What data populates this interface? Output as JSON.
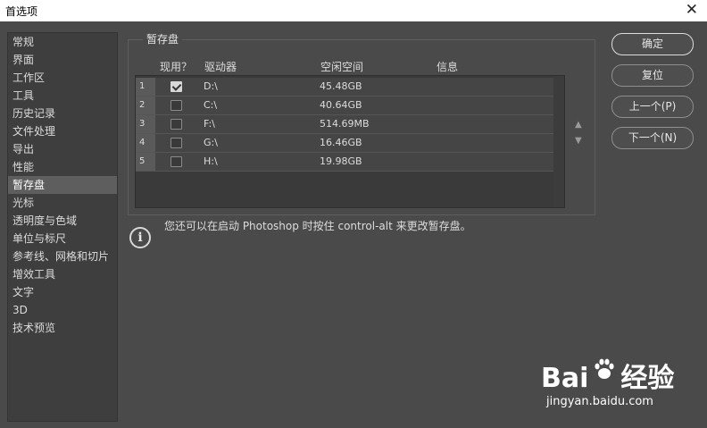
{
  "window": {
    "title": "首选项",
    "close_icon": "✕"
  },
  "sidebar": {
    "items": [
      {
        "label": "常规"
      },
      {
        "label": "界面"
      },
      {
        "label": "工作区"
      },
      {
        "label": "工具"
      },
      {
        "label": "历史记录"
      },
      {
        "label": "文件处理"
      },
      {
        "label": "导出"
      },
      {
        "label": "性能"
      },
      {
        "label": "暂存盘",
        "active": true
      },
      {
        "label": "光标"
      },
      {
        "label": "透明度与色域"
      },
      {
        "label": "单位与标尺"
      },
      {
        "label": "参考线、网格和切片"
      },
      {
        "label": "增效工具"
      },
      {
        "label": "文字"
      },
      {
        "label": "3D"
      },
      {
        "label": "技术预览"
      }
    ]
  },
  "scratch": {
    "legend": "暂存盘",
    "columns": {
      "active": "现用？",
      "drive": "驱动器",
      "free": "空闲空间",
      "info": "信息"
    },
    "rows": [
      {
        "num": "1",
        "checked": true,
        "drive": "D:\\",
        "free": "45.48GB"
      },
      {
        "num": "2",
        "checked": false,
        "drive": "C:\\",
        "free": "40.64GB"
      },
      {
        "num": "3",
        "checked": false,
        "drive": "F:\\",
        "free": "514.69MB"
      },
      {
        "num": "4",
        "checked": false,
        "drive": "G:\\",
        "free": "16.46GB"
      },
      {
        "num": "5",
        "checked": false,
        "drive": "H:\\",
        "free": "19.98GB"
      }
    ],
    "arrow_up": "▲",
    "arrow_down": "▼"
  },
  "info": {
    "icon": "i",
    "text": "您还可以在启动 Photoshop 时按住 control-alt 来更改暂存盘。"
  },
  "buttons": {
    "ok": "确定",
    "reset": "复位",
    "prev": "上一个(P)",
    "next": "下一个(N)"
  },
  "watermark": {
    "logo_left": "Bai",
    "logo_right": "经验",
    "url": "jingyan.baidu.com"
  }
}
